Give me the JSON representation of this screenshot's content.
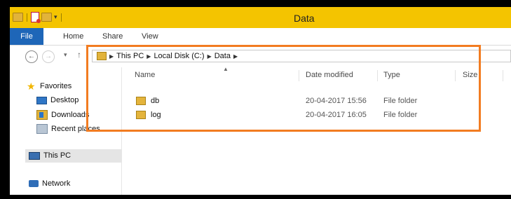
{
  "window": {
    "title": "Data"
  },
  "ribbon": {
    "tabs": [
      "File",
      "Home",
      "Share",
      "View"
    ]
  },
  "address": {
    "crumbs": [
      "This PC",
      "Local Disk (C:)",
      "Data"
    ]
  },
  "nav": {
    "favorites": "Favorites",
    "desktop": "Desktop",
    "downloads": "Downloads",
    "recent": "Recent places",
    "thispc": "This PC",
    "network": "Network"
  },
  "columns": {
    "name": "Name",
    "date": "Date modified",
    "type": "Type",
    "size": "Size"
  },
  "files": [
    {
      "name": "db",
      "date": "20-04-2017 15:56",
      "type": "File folder"
    },
    {
      "name": "log",
      "date": "20-04-2017 16:05",
      "type": "File folder"
    }
  ],
  "colors": {
    "title_bar": "#f4c400",
    "file_tab": "#1e66b8",
    "highlight": "#f27c21"
  }
}
